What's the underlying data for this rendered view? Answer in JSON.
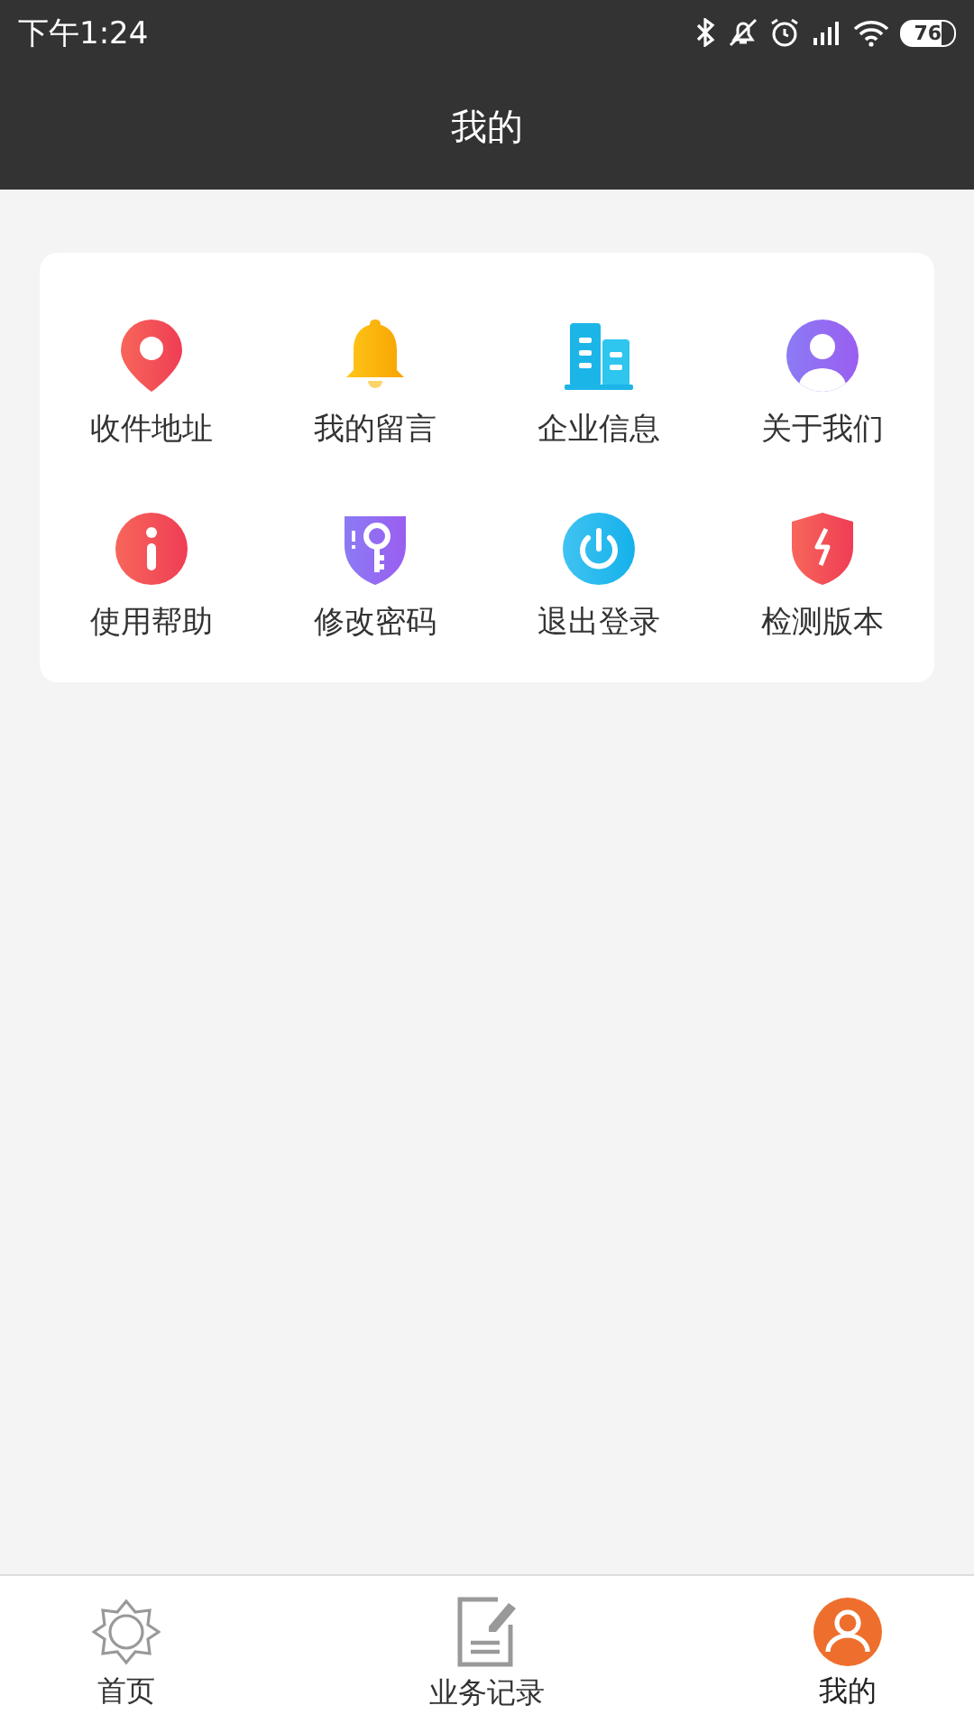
{
  "status_bar": {
    "time": "下午1:24",
    "battery": "76"
  },
  "header": {
    "title": "我的"
  },
  "menu": [
    {
      "label": "收件地址",
      "kind": "pin"
    },
    {
      "label": "我的留言",
      "kind": "bell"
    },
    {
      "label": "企业信息",
      "kind": "building"
    },
    {
      "label": "关于我们",
      "kind": "person"
    },
    {
      "label": "使用帮助",
      "kind": "info"
    },
    {
      "label": "修改密码",
      "kind": "key"
    },
    {
      "label": "退出登录",
      "kind": "power"
    },
    {
      "label": "检测版本",
      "kind": "bolt"
    }
  ],
  "tab_bar": [
    {
      "label": "首页",
      "kind": "home",
      "selected": false
    },
    {
      "label": "业务记录",
      "kind": "record",
      "selected": false
    },
    {
      "label": "我的",
      "kind": "me",
      "selected": true
    }
  ]
}
